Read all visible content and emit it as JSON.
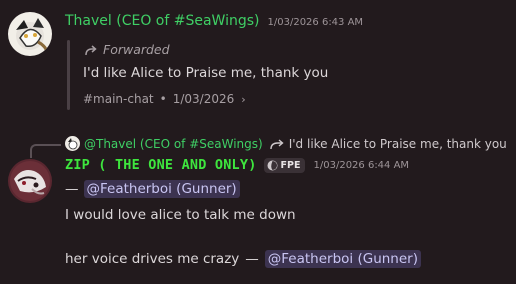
{
  "message1": {
    "author": "Thavel (CEO of #SeaWings)",
    "timestamp": "1/03/2026 6:43 AM",
    "forwarded_label": "Forwarded",
    "text": "I'd like Alice to Praise me, thank you",
    "source_channel": "#main-chat",
    "source_separator": "•",
    "source_date": "1/03/2026",
    "source_chevron": "›"
  },
  "reply": {
    "author": "@Thavel (CEO of #SeaWings)",
    "text": "I'd like Alice to Praise me, thank you"
  },
  "message2": {
    "author": "ZIP ( THE ONE AND ONLY)",
    "tag": "FPE",
    "timestamp": "1/03/2026 6:44 AM",
    "dash": "—",
    "mention": "@Featherboi (Gunner)",
    "line2": "I would love alice to talk me down",
    "line3_text": "her voice drives me crazy",
    "line3_dash": "—",
    "line3_mention": "@Featherboi (Gunner)"
  },
  "colors": {
    "background": "#221a1d",
    "author_green": "#3fcf65",
    "mention_bg": "#3c3350",
    "mention_fg": "#c9c5f2"
  },
  "icons": [
    "forward-arrow-icon",
    "chevron-right-icon",
    "reply-arrow-icon",
    "tag-icon"
  ]
}
